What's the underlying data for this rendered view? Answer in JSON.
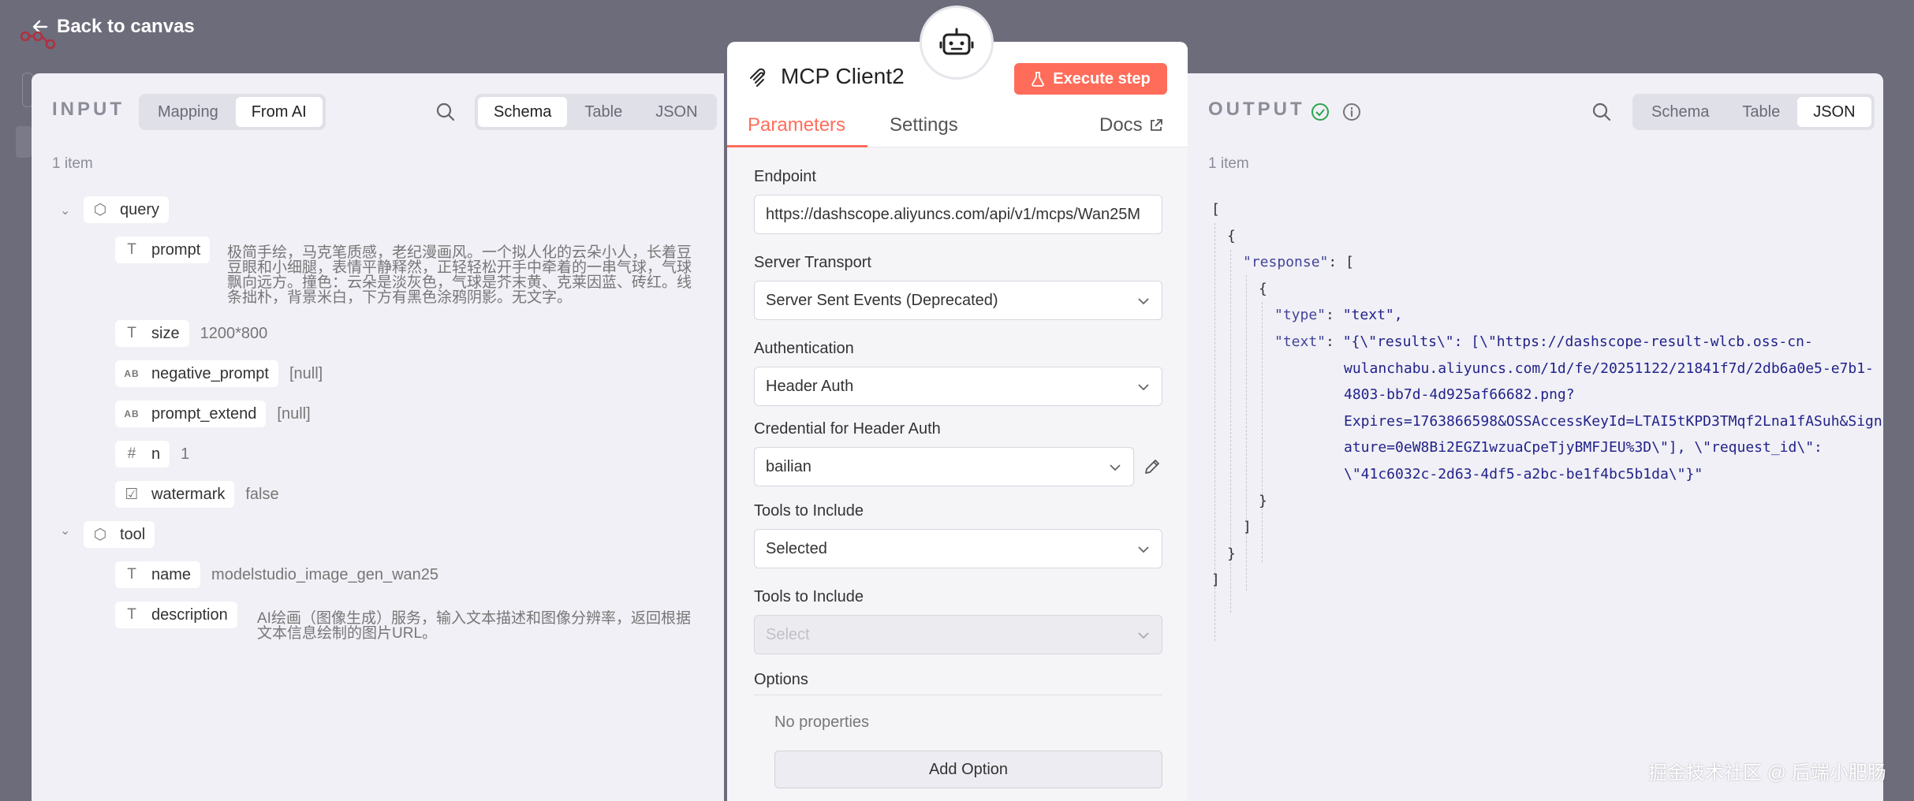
{
  "nav": {
    "back_label": "Back to canvas"
  },
  "input": {
    "title": "INPUT",
    "mode_tabs": [
      "Mapping",
      "From AI"
    ],
    "view_tabs": [
      "Schema",
      "Table",
      "JSON"
    ],
    "item_count": "1 item",
    "query": {
      "label": "query",
      "prompt_key": "prompt",
      "prompt_value": "极简手绘，马克笔质感，老纪漫画风。一个拟人化的云朵小人，长着豆豆眼和小细腿，表情平静释然，正轻轻松开手中牵着的一串气球，气球飘向远方。撞色：云朵是淡灰色，气球是芥末黄、克莱因蓝、砖红。线条拙朴，背景米白，下方有黑色涂鸦阴影。无文字。",
      "size_key": "size",
      "size_value": "1200*800",
      "negative_prompt_key": "negative_prompt",
      "negative_prompt_value": "[null]",
      "prompt_extend_key": "prompt_extend",
      "prompt_extend_value": "[null]",
      "n_key": "n",
      "n_value": "1",
      "watermark_key": "watermark",
      "watermark_value": "false"
    },
    "tool": {
      "label": "tool",
      "name_key": "name",
      "name_value": "modelstudio_image_gen_wan25",
      "description_key": "description",
      "description_value": "AI绘画（图像生成）服务，输入文本描述和图像分辨率，返回根据文本信息绘制的图片URL。"
    }
  },
  "node": {
    "title": "MCP Client2",
    "execute_label": "Execute step",
    "tabs": {
      "parameters": "Parameters",
      "settings": "Settings",
      "docs": "Docs"
    },
    "endpoint_label": "Endpoint",
    "endpoint_value": "https://dashscope.aliyuncs.com/api/v1/mcps/Wan25M",
    "transport_label": "Server Transport",
    "transport_value": "Server Sent Events (Deprecated)",
    "auth_label": "Authentication",
    "auth_value": "Header Auth",
    "credential_label": "Credential for Header Auth",
    "credential_value": "bailian",
    "tools_label": "Tools to Include",
    "tools_value": "Selected",
    "tools2_label": "Tools to Include",
    "tools2_placeholder": "Select",
    "options_label": "Options",
    "no_properties": "No properties",
    "add_option": "Add Option"
  },
  "output": {
    "title": "OUTPUT",
    "view_tabs": [
      "Schema",
      "Table",
      "JSON"
    ],
    "item_count": "1 item",
    "json": {
      "l1": "[",
      "l2": "{",
      "l3_key": "\"response\"",
      "l3_rest": ": [",
      "l4": "{",
      "l5_key": "\"type\"",
      "l5_val": "\"text\",",
      "l6_key": "\"text\"",
      "l6_val": "\"{\\\"results\\\": [\\\"https://dashscope-result-wlcb.oss-cn-",
      "l7": "wulanchabu.aliyuncs.com/1d/fe/20251122/21841f7d/2db6a0e5-e7b1-",
      "l8": "4803-bb7d-4d925af66682.png?",
      "l9": "Expires=1763866598&OSSAccessKeyId=LTAI5tKPD3TMqf2Lna1fASuh&Sign",
      "l10": "ature=0eW8Bi2EGZ1wzuaCpeTjyBMFJEU%3D\\\"], \\\"request_id\\\":",
      "l11": "\\\"41c6032c-2d63-4df5-a2bc-be1f4bc5b1da\\\"}\"",
      "l12": "}",
      "l13": "]",
      "l14": "}",
      "l15": "]"
    }
  },
  "watermark_text": "掘金技术社区 @ 后端小肥肠",
  "colors": {
    "accent": "#ff6d5a",
    "success": "#2ea44f",
    "panel_bg": "#f0f0f6"
  }
}
